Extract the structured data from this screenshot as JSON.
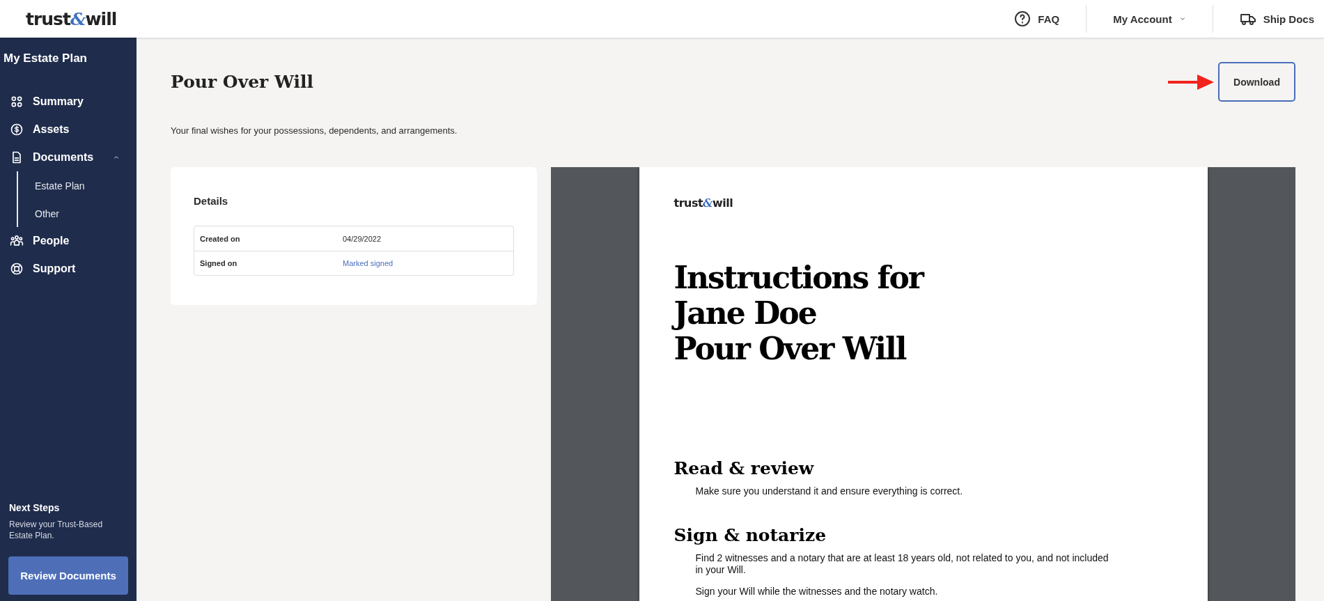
{
  "header": {
    "logo": [
      "trust",
      "&",
      "will"
    ],
    "nav": [
      {
        "kind": "help",
        "label": "FAQ"
      },
      {
        "kind": "menu",
        "label": "My Account"
      },
      {
        "kind": "truck",
        "label": "Ship Docs"
      }
    ]
  },
  "sidebar": {
    "title": "My Estate Plan",
    "items": [
      {
        "kind": "grid",
        "label": "Summary"
      },
      {
        "kind": "dollar",
        "label": "Assets"
      },
      {
        "kind": "doc",
        "label": "Documents",
        "expanded": true,
        "children": [
          {
            "label": "Estate Plan"
          },
          {
            "label": "Other"
          }
        ]
      },
      {
        "kind": "people",
        "label": "People"
      },
      {
        "kind": "support",
        "label": "Support"
      }
    ],
    "next_steps": {
      "title": "Next Steps",
      "text": "Review your Trust-Based Estate Plan.",
      "button": "Review Documents"
    }
  },
  "page": {
    "title": "Pour Over Will",
    "download": "Download",
    "description": "Your final wishes for your possessions, dependents, and arrangements.",
    "details": {
      "title": "Details",
      "rows": [
        {
          "label": "Created on",
          "value": "04/29/2022",
          "kind": "text"
        },
        {
          "label": "Signed on",
          "value": "Marked signed",
          "kind": "link"
        }
      ]
    }
  },
  "document": {
    "logo": [
      "trust",
      "&",
      "will"
    ],
    "heading": [
      "Instructions for",
      "Jane Doe",
      "Pour Over Will"
    ],
    "sections": [
      {
        "title": "Read & review",
        "paragraphs": [
          "Make sure you understand it and ensure everything is correct."
        ]
      },
      {
        "title": "Sign & notarize",
        "paragraphs": [
          "Find 2 witnesses and a notary that are at least 18 years old, not related to you, and not included in your Will.",
          "Sign your Will while the witnesses and the notary watch."
        ]
      }
    ]
  }
}
